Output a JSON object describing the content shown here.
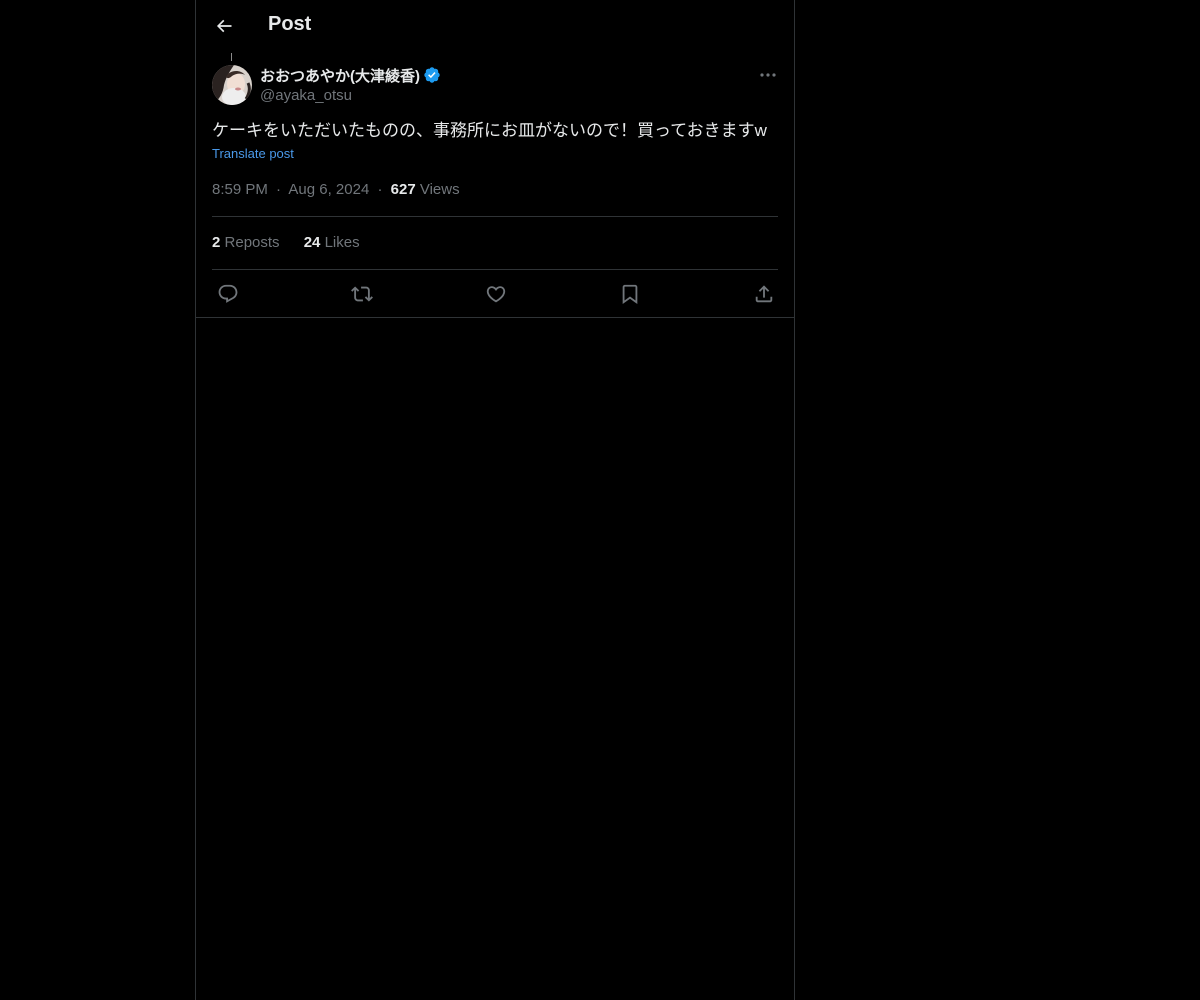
{
  "header": {
    "title": "Post",
    "back_icon": "arrow-left-icon"
  },
  "post": {
    "author": {
      "display_name": "おおつあやか(大津綾香)",
      "handle": "@ayaka_otsu",
      "verified": true,
      "verified_color": "#1d9bf0"
    },
    "text": "ケーキをいただいたものの、事務所にお皿がないので！買っておきますw",
    "translate_label": "Translate post",
    "time": "8:59 PM",
    "date": "Aug 6, 2024",
    "views_count": "627",
    "views_label": "Views",
    "separator": "·"
  },
  "stats": {
    "reposts_count": "2",
    "reposts_label": "Reposts",
    "likes_count": "24",
    "likes_label": "Likes"
  },
  "actions": [
    {
      "name": "reply",
      "icon": "reply-icon"
    },
    {
      "name": "repost",
      "icon": "repost-icon"
    },
    {
      "name": "like",
      "icon": "heart-icon"
    },
    {
      "name": "bookmark",
      "icon": "bookmark-icon"
    },
    {
      "name": "share",
      "icon": "share-icon"
    }
  ],
  "colors": {
    "background": "#000000",
    "text_primary": "#e7e9ea",
    "text_secondary": "#71767b",
    "link": "#4a99e9",
    "border": "#2f3336",
    "verified": "#1d9bf0"
  }
}
